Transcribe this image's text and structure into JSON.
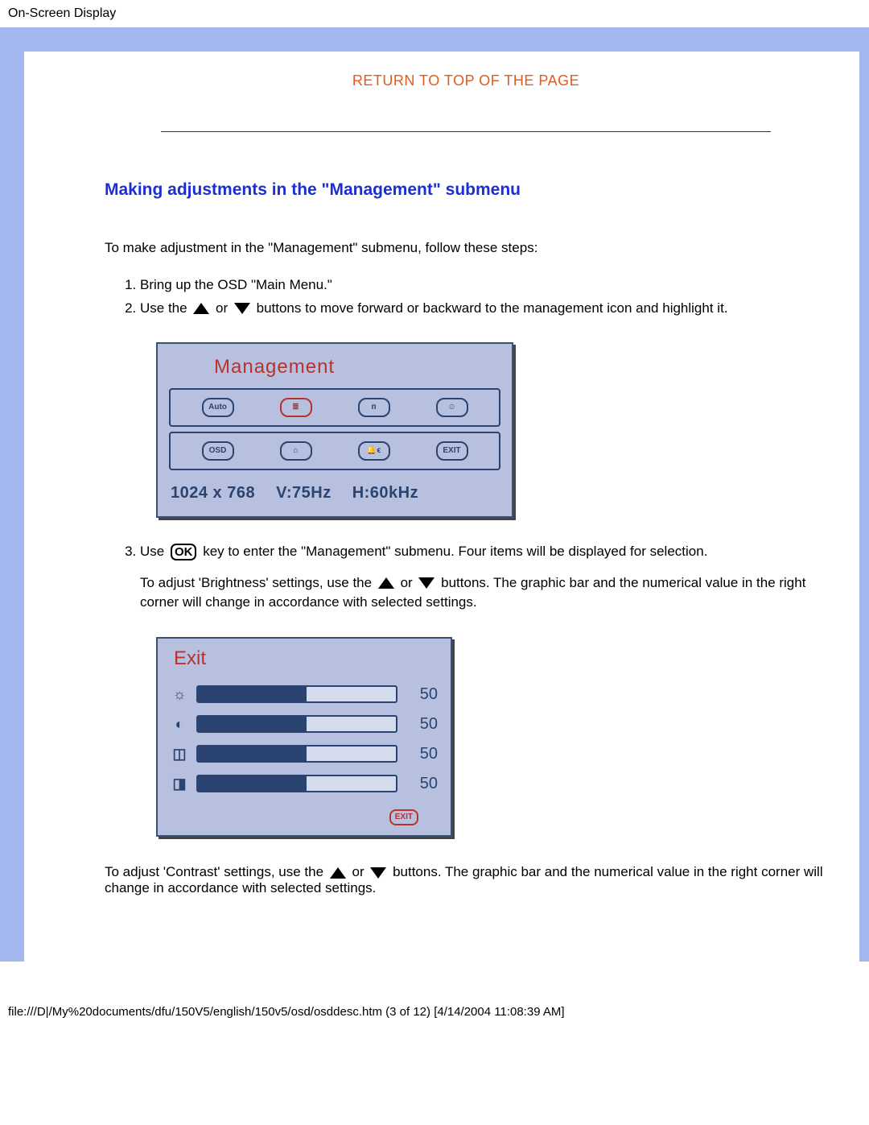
{
  "header_title": "On-Screen Display",
  "return_top": "RETURN TO TOP OF THE PAGE",
  "section_title": "Making adjustments in the \"Management\" submenu",
  "intro": "To make adjustment in the \"Management\" submenu, follow these steps:",
  "step1": "Bring up the OSD \"Main Menu.\"",
  "step2a": "Use the ",
  "step2b": " or ",
  "step2c": " buttons to move forward or backward to the management icon and highlight it.",
  "osd1": {
    "title": "Management",
    "icons_row1": [
      "Auto",
      "≣",
      "ᴨ",
      "☺"
    ],
    "icons_row2": [
      "OSD",
      "⌂",
      "🔔ϵ",
      "EXIT"
    ],
    "selected_index": 1,
    "resolution": "1024  x  768",
    "vfreq": "V:75Hz",
    "hfreq": "H:60kHz"
  },
  "step3a": "Use ",
  "step3_ok": "OK",
  "step3b": " key to enter the \"Management\" submenu. Four items will be displayed for selection.",
  "bright_a": "To adjust 'Brightness' settings, use the ",
  "bright_b": " or ",
  "bright_c": " buttons. The graphic bar and the numerical value in the right corner will change in accordance with selected settings.",
  "osd2": {
    "title": "Exit",
    "rows": [
      {
        "sym": "☼",
        "value": 50,
        "pct": 55
      },
      {
        "sym": "◐",
        "value": 50,
        "pct": 55
      },
      {
        "sym": "◫",
        "value": 50,
        "pct": 55
      },
      {
        "sym": "◨",
        "value": 50,
        "pct": 55
      }
    ],
    "exit_label": "EXIT"
  },
  "contrast_a": "To adjust 'Contrast' settings, use the ",
  "contrast_b": " or ",
  "contrast_c": " buttons. The graphic bar and the numerical value in the right corner will change in accordance with selected settings.",
  "footer": "file:///D|/My%20documents/dfu/150V5/english/150v5/osd/osddesc.htm (3 of 12) [4/14/2004 11:08:39 AM]"
}
